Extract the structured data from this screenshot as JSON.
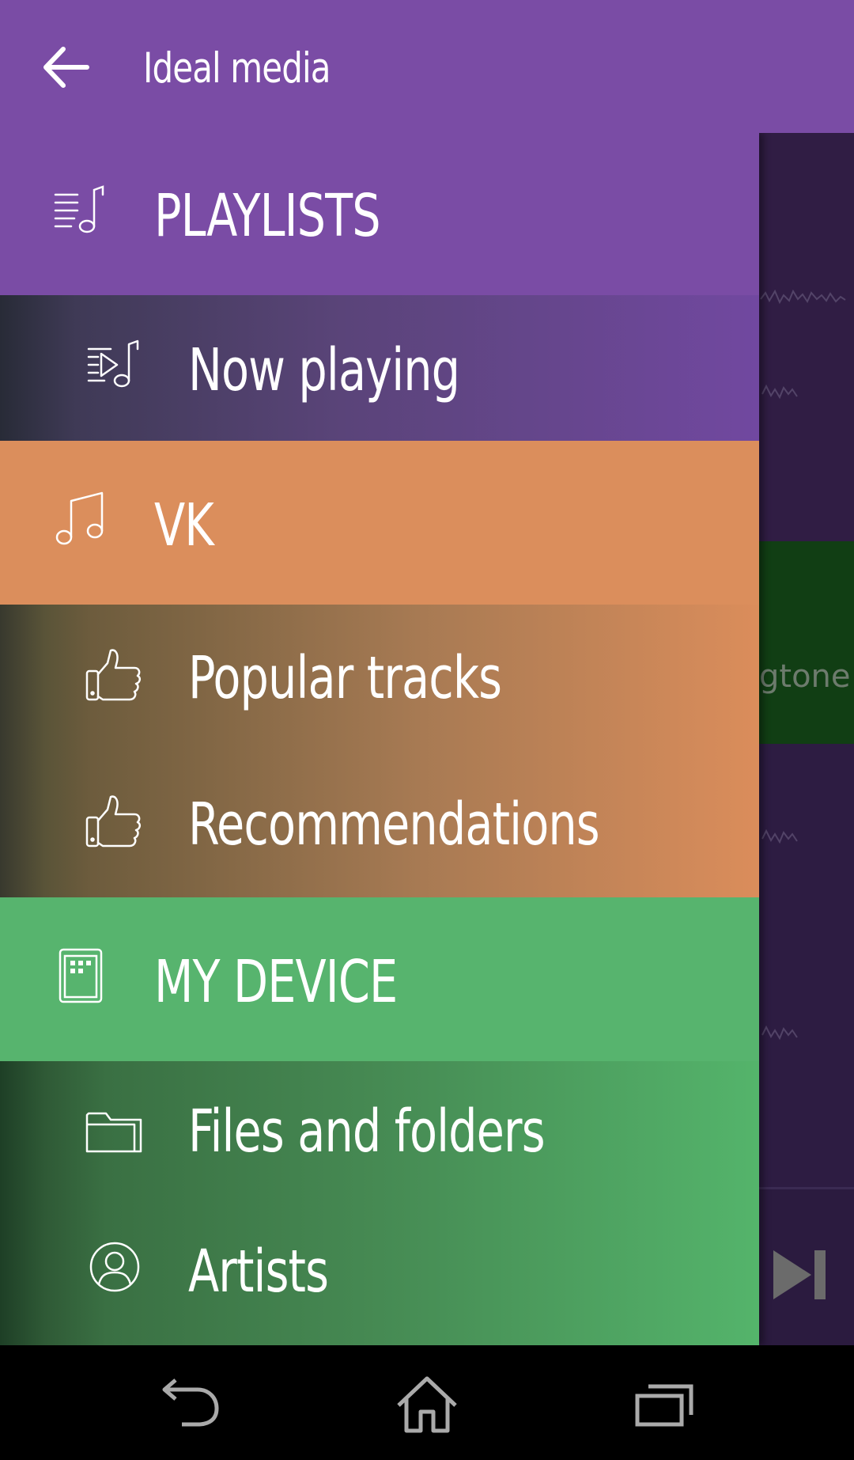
{
  "appbar": {
    "title": "Ideal media",
    "back_icon": "arrow-left-icon"
  },
  "drawer": {
    "playlists": {
      "header": "PLAYLISTS",
      "icon": "playlist-icon",
      "items": [
        {
          "label": "Now playing",
          "icon": "playlist-play-icon"
        }
      ]
    },
    "vk": {
      "header": "VK",
      "icon": "music-note-icon",
      "items": [
        {
          "label": "Popular tracks",
          "icon": "thumbs-up-icon"
        },
        {
          "label": "Recommendations",
          "icon": "thumbs-up-icon"
        }
      ]
    },
    "device": {
      "header": "MY DEVICE",
      "icon": "device-icon",
      "items": [
        {
          "label": "Files and folders",
          "icon": "folder-icon"
        },
        {
          "label": "Artists",
          "icon": "person-icon"
        }
      ]
    }
  },
  "background": {
    "partial_text": "gtone",
    "next_icon": "skip-next-icon"
  },
  "navbar": {
    "back_icon": "nav-back-icon",
    "home_icon": "nav-home-icon",
    "recents_icon": "nav-recents-icon"
  },
  "colors": {
    "purple": "#7a4ca5",
    "orange": "#db8e5c",
    "green": "#57b46e",
    "navbar": "#000000"
  }
}
